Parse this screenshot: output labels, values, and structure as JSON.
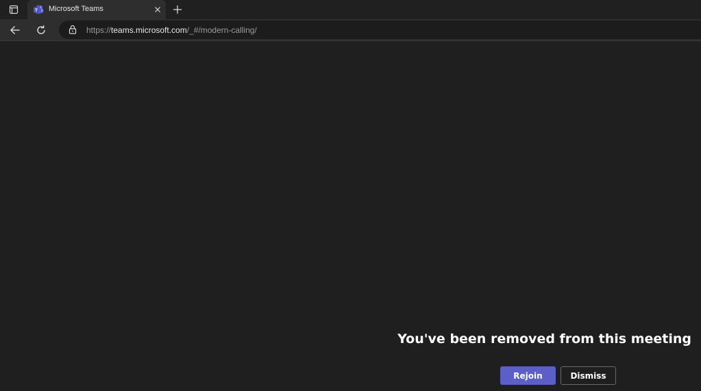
{
  "browser": {
    "tab": {
      "title": "Microsoft Teams",
      "favicon": "teams-logo-icon"
    },
    "address": {
      "scheme": "https://",
      "host": "teams.microsoft.com",
      "path": "/_#/modern-calling/"
    },
    "icons": {
      "tab_actions": "tab-actions-icon",
      "close": "close-icon",
      "new_tab": "plus-icon",
      "back": "back-arrow-icon",
      "refresh": "refresh-icon",
      "lock": "lock-icon"
    }
  },
  "meeting": {
    "message": "You've been removed from this meeting",
    "rejoin_label": "Rejoin",
    "dismiss_label": "Dismiss"
  },
  "colors": {
    "background": "#1f1f1f",
    "accent": "#5b5fc7"
  }
}
